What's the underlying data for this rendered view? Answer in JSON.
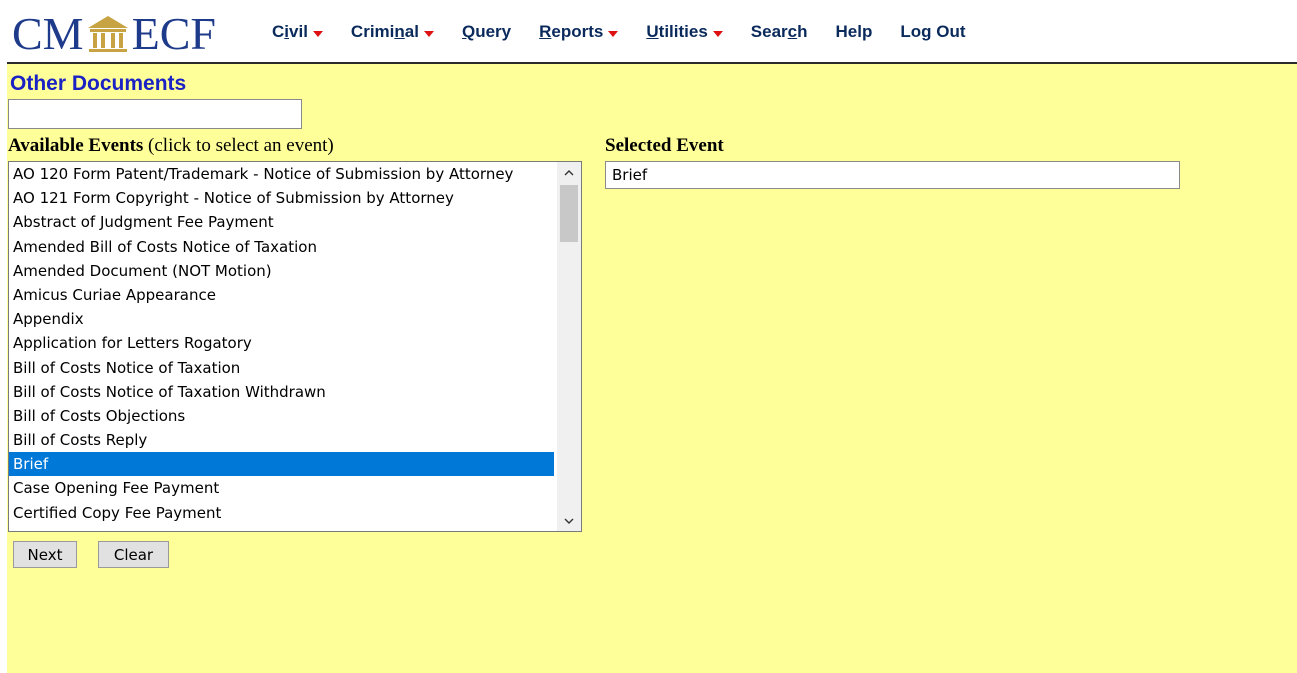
{
  "header": {
    "logo_left": "CM",
    "logo_right": "ECF",
    "logo_icon": "courthouse-icon",
    "nav": [
      {
        "label_pre": "C",
        "label_ul": "i",
        "label_post": "vil",
        "has_caret": true
      },
      {
        "label_pre": "Crimi",
        "label_ul": "n",
        "label_post": "al",
        "has_caret": true
      },
      {
        "label_pre": "",
        "label_ul": "Q",
        "label_post": "uery",
        "has_caret": false
      },
      {
        "label_pre": "",
        "label_ul": "R",
        "label_post": "eports",
        "has_caret": true
      },
      {
        "label_pre": "",
        "label_ul": "U",
        "label_post": "tilities",
        "has_caret": true
      },
      {
        "label_pre": "Sear",
        "label_ul": "c",
        "label_post": "h",
        "has_caret": false
      },
      {
        "label_pre": "Help",
        "label_ul": "",
        "label_post": "",
        "has_caret": false
      },
      {
        "label_pre": "Log Out",
        "label_ul": "",
        "label_post": "",
        "has_caret": false
      }
    ]
  },
  "page": {
    "title": "Other Documents",
    "filter_value": "",
    "available_label_bold": "Available Events",
    "available_label_hint": "(click to select an event)",
    "selected_label": "Selected Event",
    "selected_value": "Brief"
  },
  "events": [
    "AO 120 Form Patent/Trademark - Notice of Submission by Attorney",
    "AO 121 Form Copyright - Notice of Submission by Attorney",
    "Abstract of Judgment Fee Payment",
    "Amended Bill of Costs Notice of Taxation",
    "Amended Document (NOT Motion)",
    "Amicus Curiae Appearance",
    "Appendix",
    "Application for Letters Rogatory",
    "Bill of Costs Notice of Taxation",
    "Bill of Costs Notice of Taxation Withdrawn",
    "Bill of Costs Objections",
    "Bill of Costs Reply",
    "Brief",
    "Case Opening Fee Payment",
    "Certified Copy Fee Payment"
  ],
  "selected_index": 12,
  "buttons": {
    "next": "Next",
    "clear": "Clear"
  },
  "colors": {
    "content_bg": "#ffff99",
    "title": "#1b22c4",
    "selection": "#0078d7",
    "caret": "#dd1111"
  }
}
